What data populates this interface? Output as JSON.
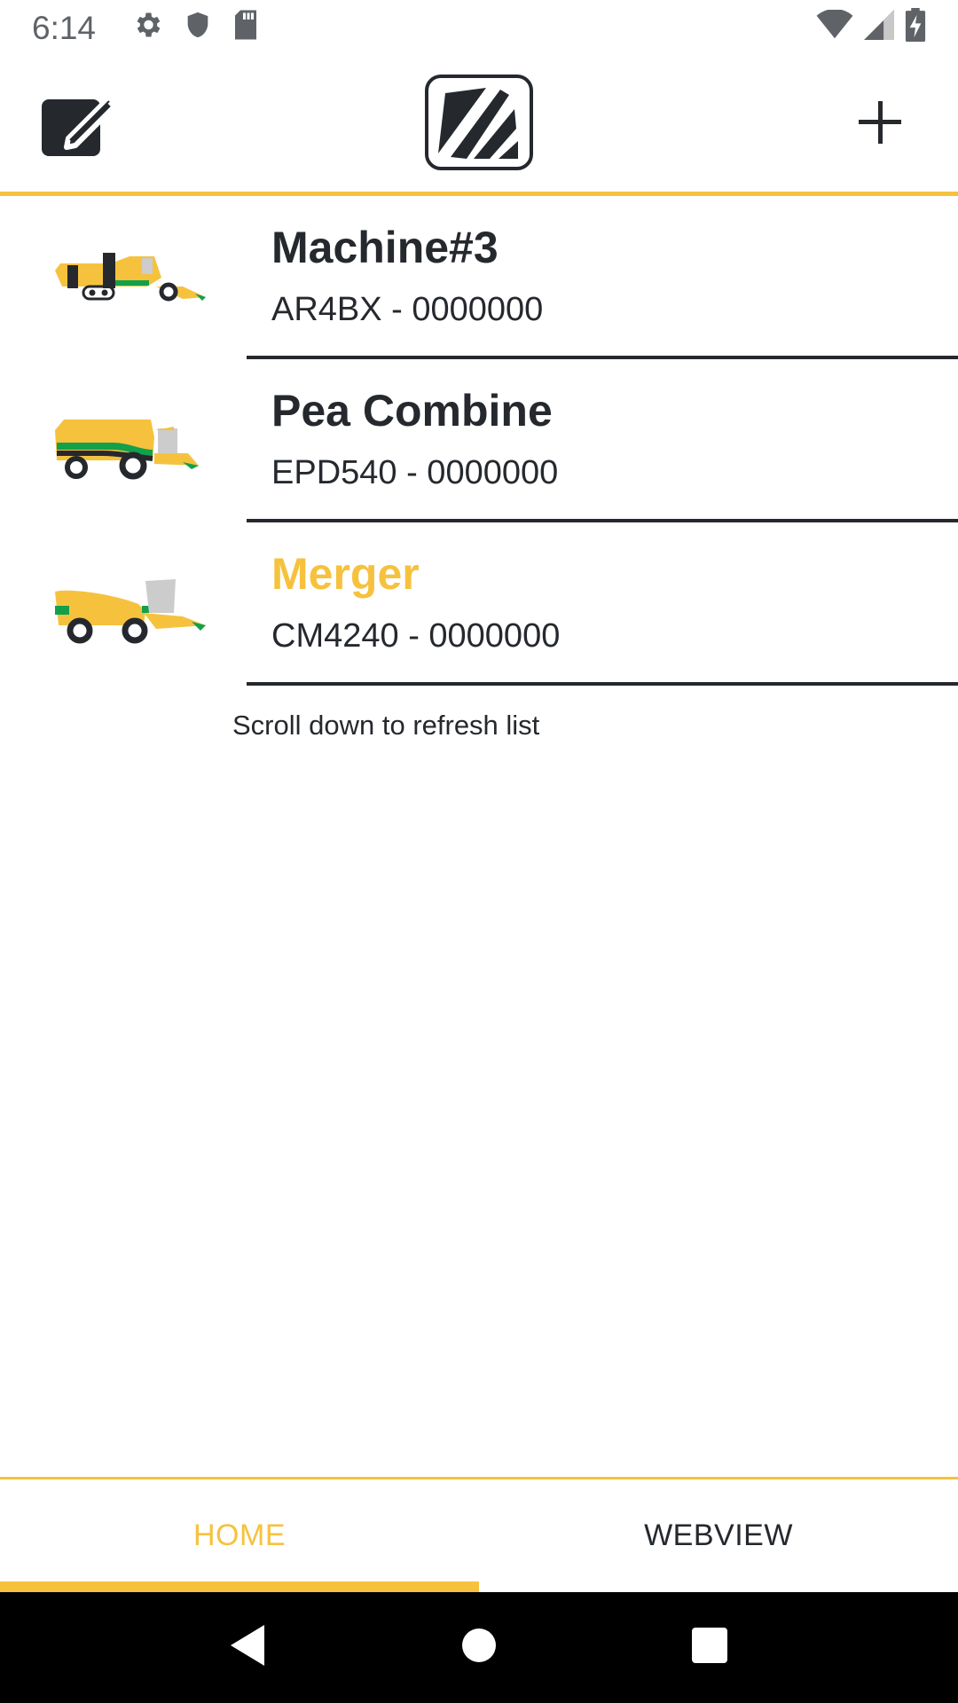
{
  "status_bar": {
    "time": "6:14",
    "icons": [
      "gear-icon",
      "shield-icon",
      "sd-card-icon"
    ],
    "right_icons": [
      "wifi-icon",
      "signal-icon",
      "battery-charging-icon"
    ]
  },
  "app_bar": {
    "left_icon": "edit-icon",
    "logo": "brand-logo",
    "right_icon": "plus-icon"
  },
  "colors": {
    "accent": "#f6c23e",
    "text": "#25292e",
    "green": "#12a04b"
  },
  "machines": [
    {
      "name": "Machine#3",
      "serial": "AR4BX - 0000000",
      "icon": "tracked-harvester-icon"
    },
    {
      "name": "Pea Combine",
      "serial": "EPD540 - 0000000",
      "icon": "pea-combine-icon"
    },
    {
      "name": "Merger",
      "serial": "CM4240 - 0000000",
      "icon": "merger-icon"
    }
  ],
  "refresh_hint": "Scroll down to refresh list",
  "tabs": [
    {
      "label": "HOME",
      "active": true
    },
    {
      "label": "WEBVIEW",
      "active": false
    }
  ],
  "nav": [
    "back-icon",
    "home-icon",
    "recents-icon"
  ]
}
